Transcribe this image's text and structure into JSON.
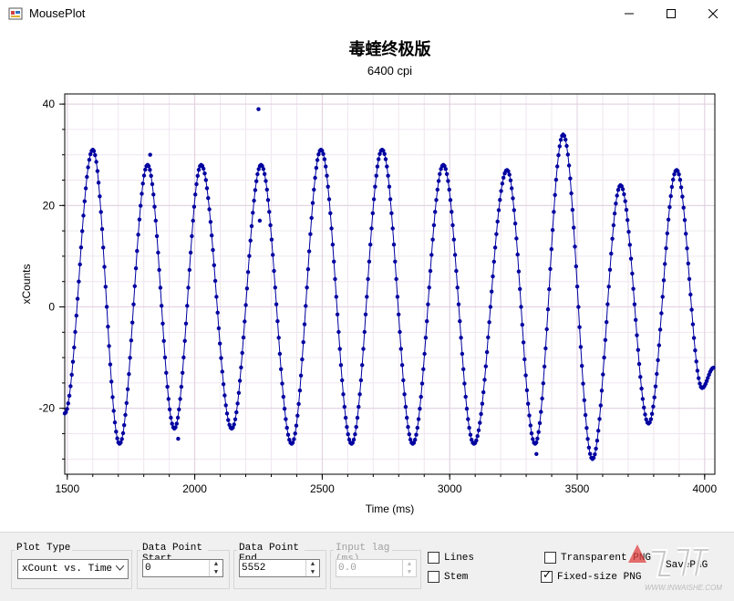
{
  "window": {
    "title": "MousePlot",
    "minimize_icon": "minimize-icon",
    "maximize_icon": "maximize-icon",
    "close_icon": "close-icon"
  },
  "chart_data": {
    "type": "scatter",
    "title": "毒蝰终极版",
    "subtitle": "6400 cpi",
    "xlabel": "Time (ms)",
    "ylabel": "xCounts",
    "xlim": [
      1490,
      4040
    ],
    "ylim": [
      -33,
      42
    ],
    "xticks": [
      1500,
      2000,
      2500,
      3000,
      3500,
      4000
    ],
    "yticks": [
      -20,
      0,
      20,
      40
    ],
    "grid": true,
    "series_color": "#0000a0",
    "peaks": [
      {
        "x": 1600,
        "y": 31
      },
      {
        "x": 1815,
        "y": 28
      },
      {
        "x": 2025,
        "y": 28
      },
      {
        "x": 2260,
        "y": 28
      },
      {
        "x": 2495,
        "y": 31
      },
      {
        "x": 2735,
        "y": 31
      },
      {
        "x": 2975,
        "y": 28
      },
      {
        "x": 3225,
        "y": 27
      },
      {
        "x": 3445,
        "y": 34
      },
      {
        "x": 3670,
        "y": 24
      },
      {
        "x": 3890,
        "y": 27
      }
    ],
    "troughs": [
      {
        "x": 1490,
        "y": -21
      },
      {
        "x": 1705,
        "y": -27
      },
      {
        "x": 1920,
        "y": -24
      },
      {
        "x": 2145,
        "y": -24
      },
      {
        "x": 2380,
        "y": -27
      },
      {
        "x": 2615,
        "y": -27
      },
      {
        "x": 2855,
        "y": -27
      },
      {
        "x": 3095,
        "y": -27
      },
      {
        "x": 3335,
        "y": -27
      },
      {
        "x": 3560,
        "y": -30
      },
      {
        "x": 3780,
        "y": -23
      },
      {
        "x": 3990,
        "y": -16
      },
      {
        "x": 4035,
        "y": -12
      }
    ],
    "outliers": [
      {
        "x": 2250,
        "y": 39
      },
      {
        "x": 2255,
        "y": 17
      },
      {
        "x": 1825,
        "y": 30
      },
      {
        "x": 1935,
        "y": -26
      },
      {
        "x": 3340,
        "y": -29
      }
    ]
  },
  "controls": {
    "plot_type": {
      "label": "Plot Type",
      "value": "xCount vs. Time"
    },
    "start": {
      "label": "Data Point Start",
      "value": "0"
    },
    "end": {
      "label": "Data Point End",
      "value": "5552"
    },
    "lag": {
      "label": "Input lag (ms)",
      "value": "0.0"
    },
    "lines": {
      "label": "Lines",
      "checked": false
    },
    "stem": {
      "label": "Stem",
      "checked": false
    },
    "transparent": {
      "label": "Transparent PNG",
      "checked": false
    },
    "fixed": {
      "label": "Fixed-size PNG",
      "checked": true
    },
    "save_label": "SavePNG",
    "check_mark": "✓"
  },
  "watermark": {
    "text": "WWW.INWAISHE.COM"
  }
}
